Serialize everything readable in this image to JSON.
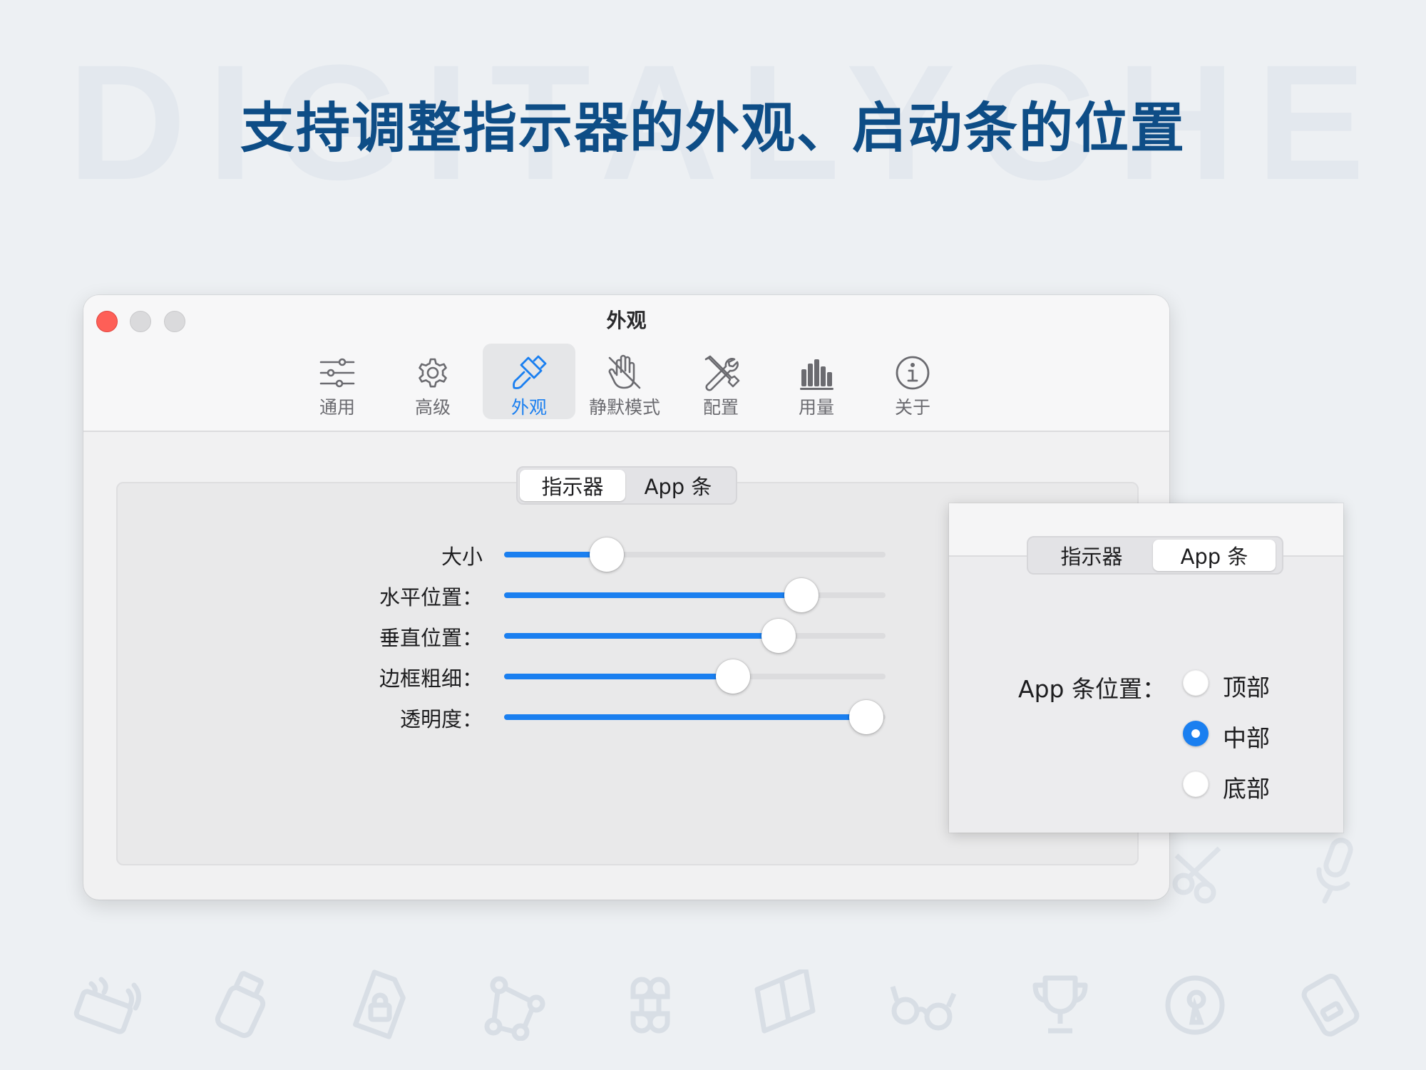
{
  "watermark": "DIGITALYCHEE",
  "headline": "支持调整指示器的外观、启动条的位置",
  "window": {
    "title": "外观",
    "toolbar": [
      {
        "label": "通用",
        "icon": "sliders-icon",
        "active": false
      },
      {
        "label": "高级",
        "icon": "gear-icon",
        "active": false
      },
      {
        "label": "外观",
        "icon": "paintbrush-icon",
        "active": true
      },
      {
        "label": "静默模式",
        "icon": "hand-slash-icon",
        "active": false
      },
      {
        "label": "配置",
        "icon": "wrench-screwdriver-icon",
        "active": false
      },
      {
        "label": "用量",
        "icon": "bar-chart-icon",
        "active": false
      },
      {
        "label": "关于",
        "icon": "info-icon",
        "active": false
      }
    ],
    "segmented": {
      "options": [
        "指示器",
        "App 条"
      ],
      "selected": 0
    },
    "sliders": [
      {
        "label": "大小",
        "value": 0.27
      },
      {
        "label": "水平位置：",
        "value": 0.78
      },
      {
        "label": "垂直位置：",
        "value": 0.72
      },
      {
        "label": "边框粗细：",
        "value": 0.6
      },
      {
        "label": "透明度：",
        "value": 0.95
      }
    ]
  },
  "overlay": {
    "segmented": {
      "options": [
        "指示器",
        "App 条"
      ],
      "selected": 1
    },
    "position_label": "App 条位置：",
    "options": [
      {
        "label": "顶部",
        "checked": false
      },
      {
        "label": "中部",
        "checked": true
      },
      {
        "label": "底部",
        "checked": false
      }
    ]
  },
  "colors": {
    "accent": "#1a7ff0",
    "headline": "#0e4d86",
    "close": "#fe5f57"
  },
  "background_icons": [
    "printer-icon",
    "usb-drive-icon",
    "locked-file-icon",
    "vector-nodes-icon",
    "command-key-icon",
    "book-icon",
    "glasses-icon",
    "trophy-icon",
    "keyhole-icon",
    "hard-drive-icon"
  ]
}
